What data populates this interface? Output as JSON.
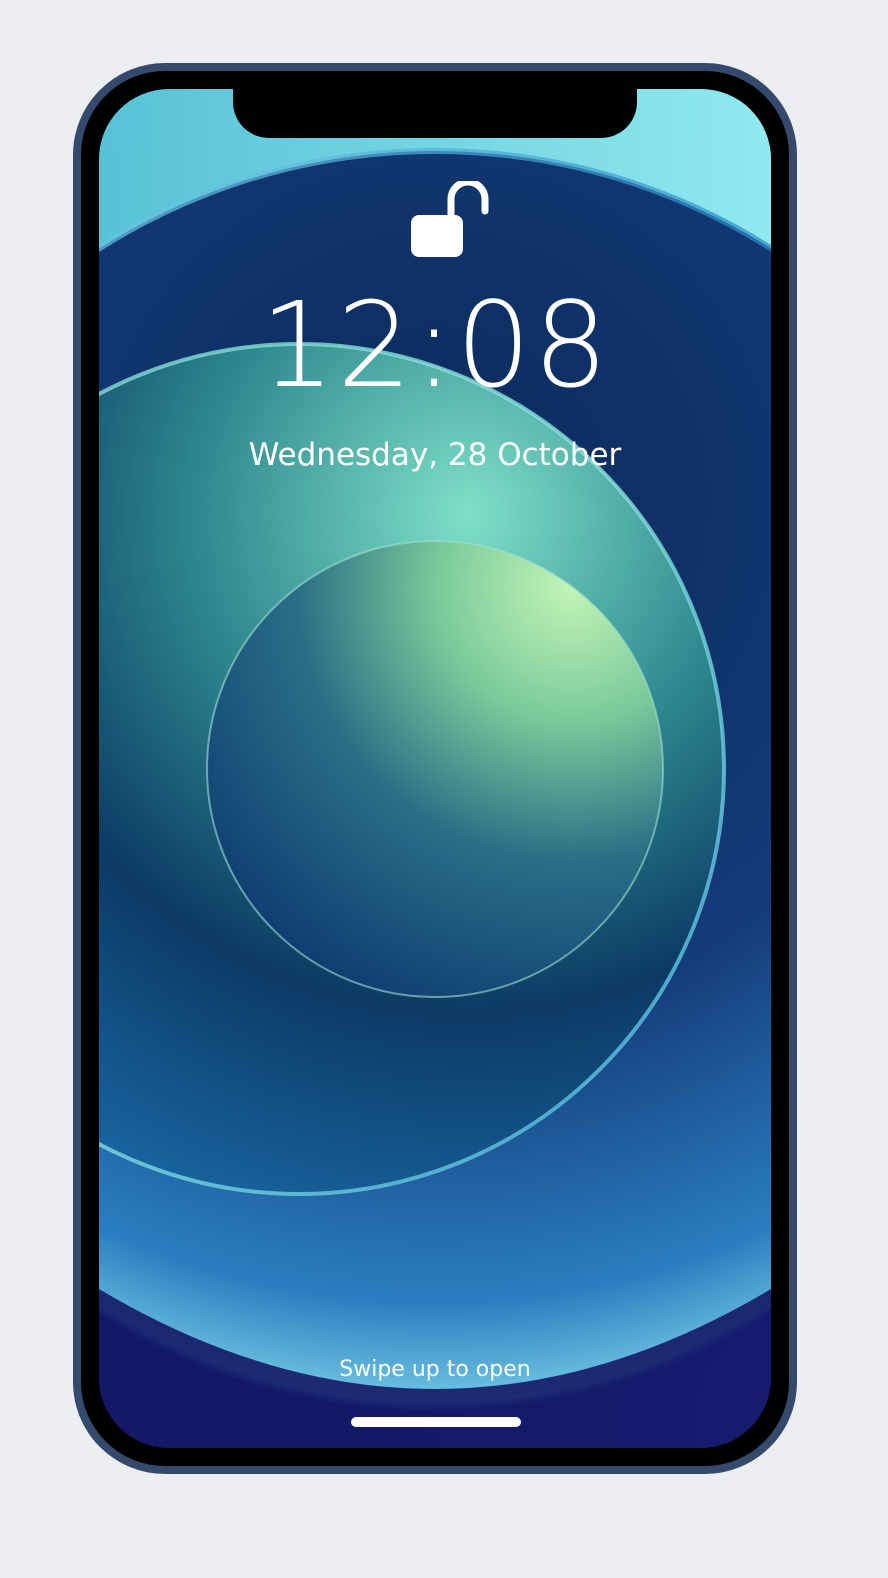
{
  "lock_screen": {
    "lock_icon": "unlocked-padlock-icon",
    "time": "12:08",
    "date": "Wednesday, 28 October",
    "hint": "Swipe up to open"
  },
  "device": {
    "frame_color": "#34496b",
    "background_color": "#eceef1"
  }
}
